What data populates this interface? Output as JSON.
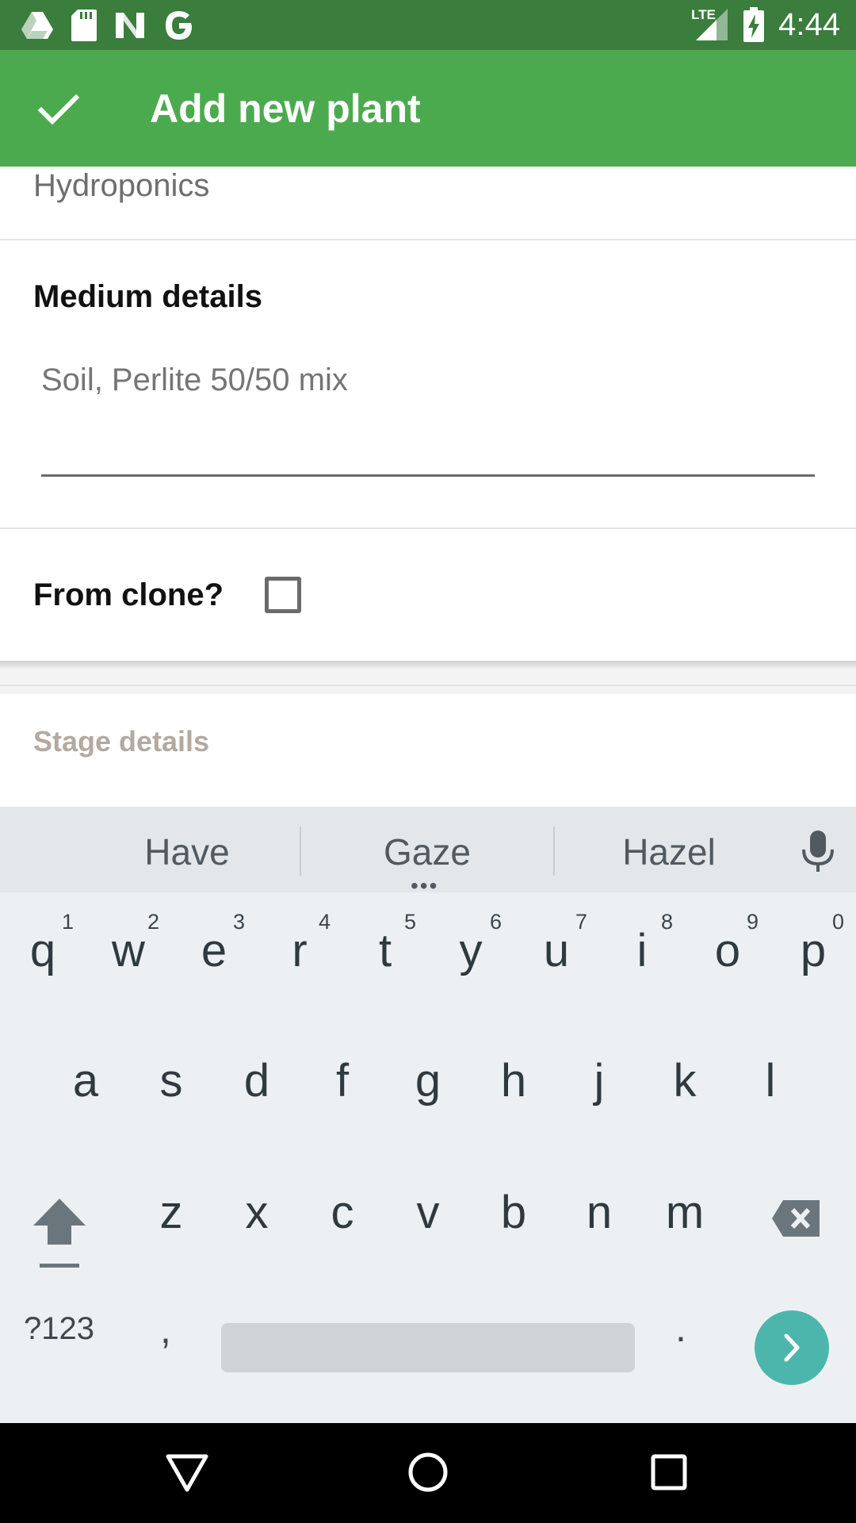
{
  "status_bar": {
    "time": "4:44",
    "network": "LTE",
    "left_icons": [
      "drive-icon",
      "sd-card-icon",
      "n-app-icon",
      "google-icon"
    ],
    "right_icons": [
      "signal-icon",
      "battery-charging-icon"
    ]
  },
  "app_bar": {
    "title": "Add new plant",
    "action_icon": "check-icon",
    "color": "#4caa4e"
  },
  "form": {
    "medium_value": "Hydroponics",
    "medium_details_label": "Medium details",
    "medium_details_placeholder": "Soil, Perlite 50/50 mix",
    "from_clone_label": "From clone?",
    "from_clone_checked": false,
    "stage_details_title": "Stage details"
  },
  "keyboard": {
    "suggestions": [
      "Have",
      "Gaze",
      "Hazel"
    ],
    "row1": [
      {
        "ch": "q",
        "num": "1"
      },
      {
        "ch": "w",
        "num": "2"
      },
      {
        "ch": "e",
        "num": "3"
      },
      {
        "ch": "r",
        "num": "4"
      },
      {
        "ch": "t",
        "num": "5"
      },
      {
        "ch": "y",
        "num": "6"
      },
      {
        "ch": "u",
        "num": "7"
      },
      {
        "ch": "i",
        "num": "8"
      },
      {
        "ch": "o",
        "num": "9"
      },
      {
        "ch": "p",
        "num": "0"
      }
    ],
    "row2": [
      "a",
      "s",
      "d",
      "f",
      "g",
      "h",
      "j",
      "k",
      "l"
    ],
    "row3": [
      "z",
      "x",
      "c",
      "v",
      "b",
      "n",
      "m"
    ],
    "symbols_label": "?123",
    "comma_label": ",",
    "period_label": ".",
    "accent_color": "#4db6ac"
  },
  "nav_bar": {
    "buttons": [
      "back-icon",
      "home-icon",
      "recents-icon"
    ]
  }
}
